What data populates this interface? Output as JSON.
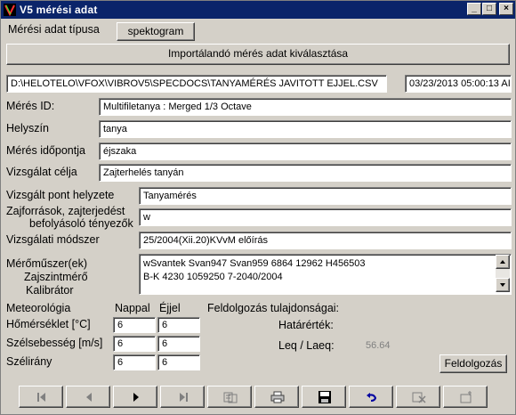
{
  "window": {
    "title": "V5 mérési adat"
  },
  "meres_tipus": {
    "label": "Mérési adat típusa",
    "button": "spektogram"
  },
  "import_button": "Importálandó mérés adat kiválasztása",
  "file": {
    "path": "D:\\HELOTELO\\VFOX\\VIBROV5\\SPECDOCS\\TANYAMÉRÉS  JAVITOTT  EJJEL.CSV",
    "datetime": "03/23/2013 05:00:13 AI"
  },
  "fields": {
    "meres_id": {
      "label": "Mérés ID:",
      "value": "Multifiletanya : Merged 1/3 Octave"
    },
    "helyszin": {
      "label": "Helyszín",
      "value": "tanya"
    },
    "idopont": {
      "label": "Mérés időpontja",
      "value": "éjszaka"
    },
    "cel": {
      "label": "Vizsgálat célja",
      "value": "Zajterhelés tanyán"
    },
    "pont": {
      "label": "Vizsgált pont helyzete",
      "value": "Tanyamérés"
    },
    "zajforras": {
      "label_line1": "Zajforrások, zajterjedést",
      "label_line2": "befolyásoló tényezők",
      "value": "w"
    },
    "modszer": {
      "label": "Vizsgálati módszer",
      "value": "25/2004(Xii.20)KVvM előírás"
    }
  },
  "meromuszer": {
    "label": "Mérőműszer(ek)",
    "sub1": "Zajszintmérő",
    "sub2": "Kalibrátor",
    "line1": "wSvantek Svan947   Svan959 6864    12962  H456503",
    "line2": "B-K 4230    1059250   7-2040/2004"
  },
  "meteo": {
    "title": "Meteorológia",
    "col_day": "Nappal",
    "col_night": "Éjjel",
    "rows": [
      {
        "label": "Hőmérséklet [°C]",
        "day": "6",
        "night": "6"
      },
      {
        "label": "Szélsebesség [m/s]",
        "day": "6",
        "night": "6"
      },
      {
        "label": "Szélirány",
        "day": "6",
        "night": "6"
      }
    ]
  },
  "feldolgozas": {
    "title": "Feldolgozás tulajdonságai:",
    "hatarertek_label": "Határérték:",
    "leq_label": "Leq / Laeq:",
    "leq_value": "56.64",
    "button": "Feldolgozás"
  },
  "toolbar": {
    "icons": [
      "first-record-icon",
      "prev-record-icon",
      "next-record-icon",
      "last-record-icon",
      "search-records-icon",
      "print-icon",
      "save-icon",
      "undo-icon",
      "delete-icon",
      "new-record-icon"
    ]
  }
}
